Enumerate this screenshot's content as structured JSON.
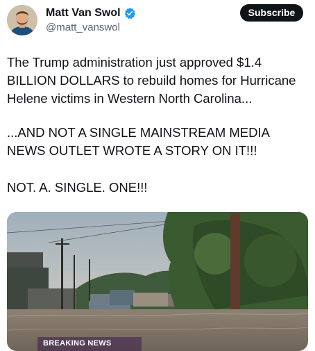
{
  "author": {
    "name": "Matt Van Swol",
    "handle": "@matt_vanswol",
    "verified_color": "#1d9bf0"
  },
  "actions": {
    "subscribe_label": "Subscribe"
  },
  "tweet": {
    "paragraph_1": "The Trump administration just approved $1.4 BILLION DOLLARS to rebuild homes for Hurricane Helene victims in Western North Carolina...",
    "paragraph_2": "...AND NOT A SINGLE MAINSTREAM MEDIA NEWS OUTLET WROTE A STORY ON IT!!!",
    "paragraph_3": "NOT. A. SINGLE. ONE!!!"
  },
  "media": {
    "caption": "BREAKING NEWS"
  }
}
